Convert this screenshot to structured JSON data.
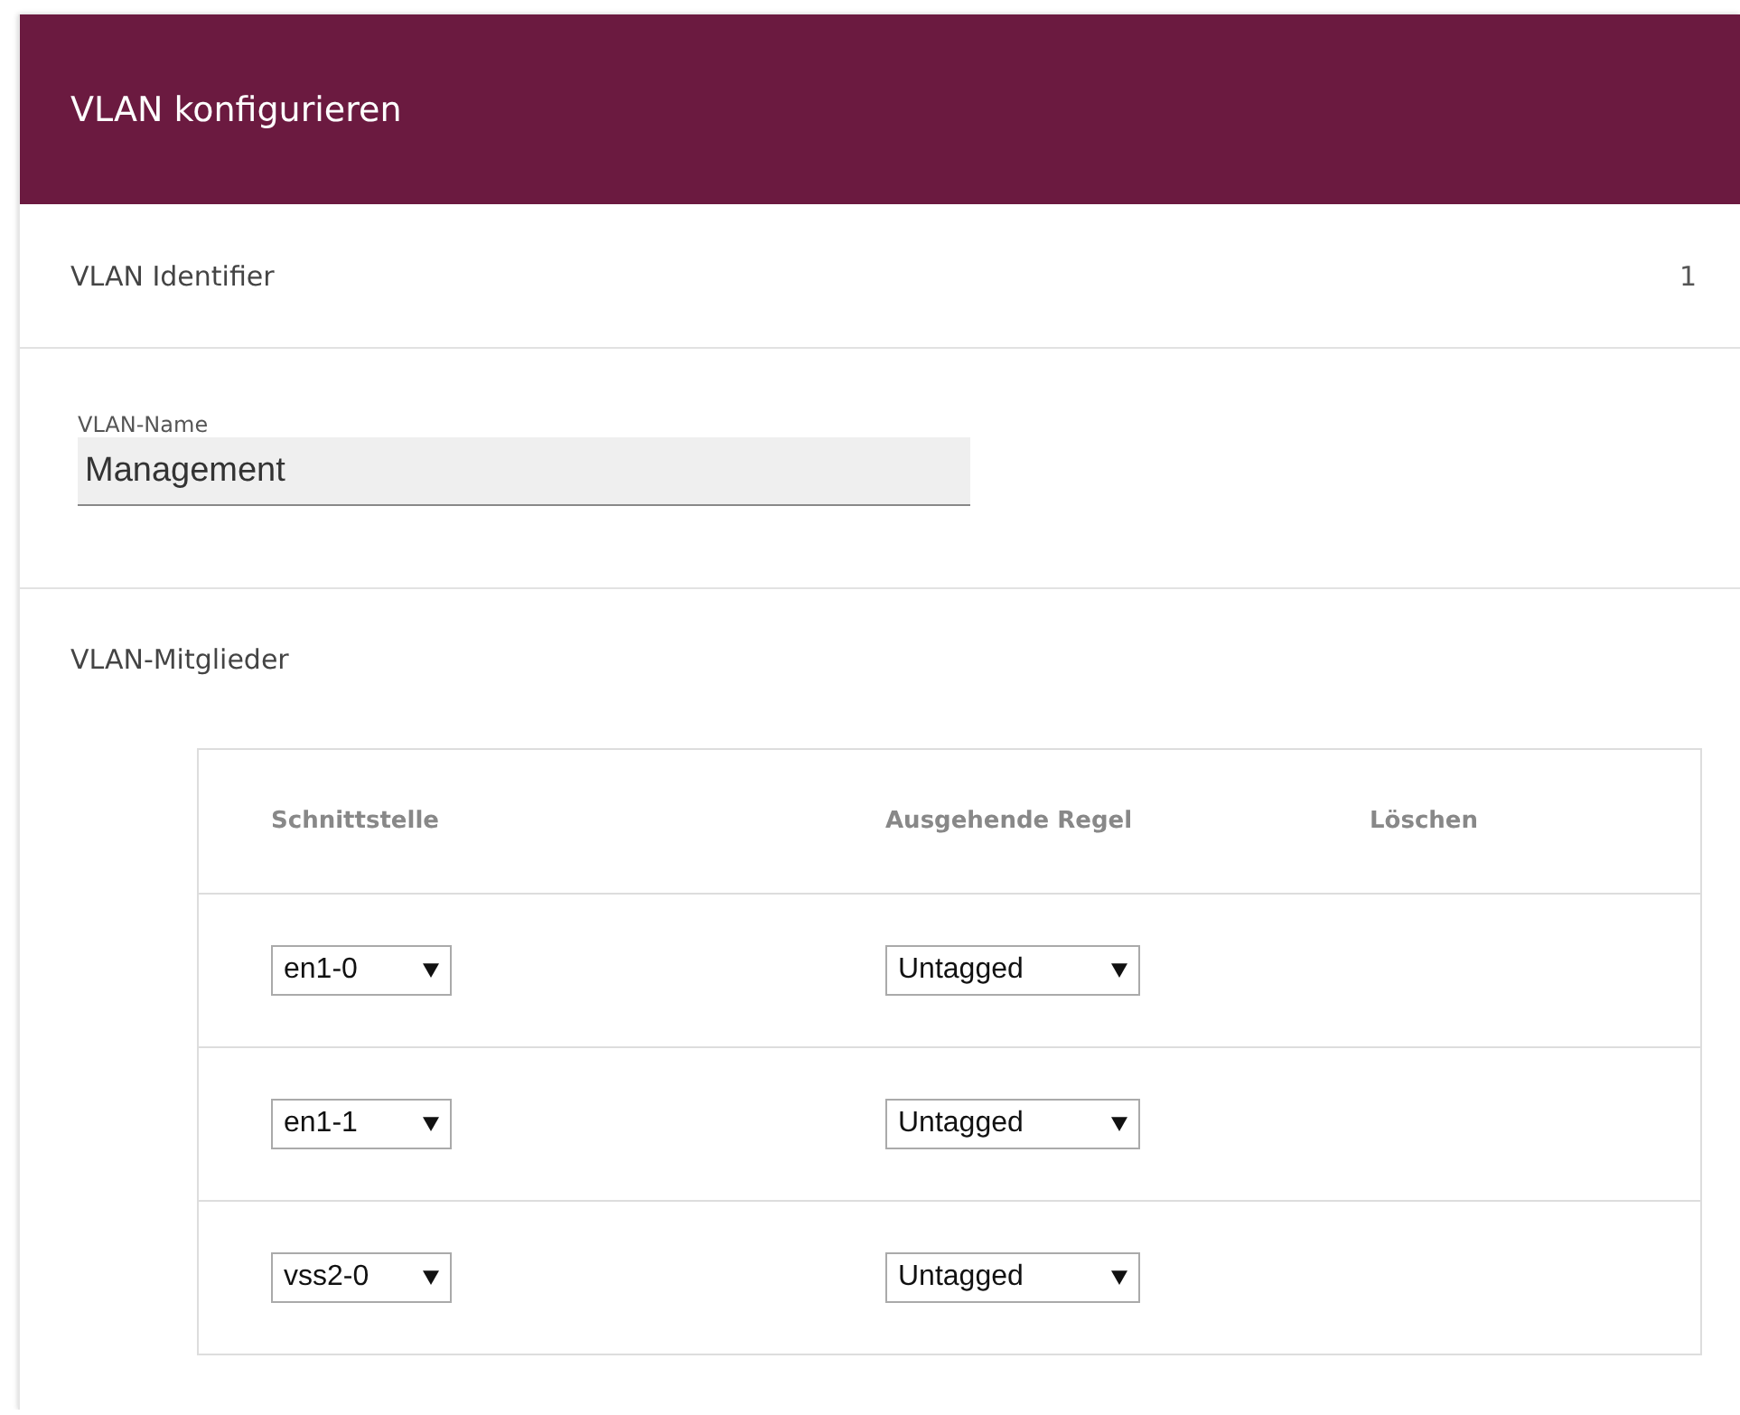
{
  "panel": {
    "title": "VLAN konfigurieren"
  },
  "identifier": {
    "label": "VLAN Identifier",
    "value": "1"
  },
  "name_field": {
    "label": "VLAN-Name",
    "value": "Management"
  },
  "members": {
    "label": "VLAN-Mitglieder",
    "columns": [
      "Schnittstelle",
      "Ausgehende Regel",
      "Löschen"
    ],
    "rows": [
      {
        "interface": "en1-0",
        "rule": "Untagged"
      },
      {
        "interface": "en1-1",
        "rule": "Untagged"
      },
      {
        "interface": "vss2-0",
        "rule": "Untagged"
      }
    ]
  }
}
